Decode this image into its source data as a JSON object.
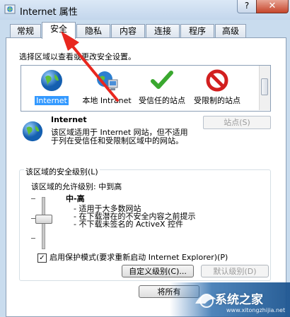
{
  "window": {
    "title": "Internet 属性",
    "help_label": "?",
    "close_label": "✕"
  },
  "tabs": [
    {
      "label": "常规",
      "active": false
    },
    {
      "label": "安全",
      "active": true
    },
    {
      "label": "隐私",
      "active": false
    },
    {
      "label": "内容",
      "active": false
    },
    {
      "label": "连接",
      "active": false
    },
    {
      "label": "程序",
      "active": false
    },
    {
      "label": "高级",
      "active": false
    }
  ],
  "security": {
    "zone_prompt": "选择区域以查看或更改安全设置。",
    "zones": [
      {
        "icon": "globe-icon",
        "label": "Internet",
        "selected": true
      },
      {
        "icon": "intranet-icon",
        "label": "本地 Intranet",
        "selected": false
      },
      {
        "icon": "checkmark-icon",
        "label": "受信任的站点",
        "selected": false
      },
      {
        "icon": "restricted-icon",
        "label": "受限制的站点",
        "selected": false
      }
    ],
    "zone_title": "Internet",
    "sites_button": "站点(S)",
    "zone_description": "该区域适用于 Internet 网站，但不适用于列在受信任和受限制区域中的网站。",
    "level_group_label": "该区域的安全级别(L)",
    "allowed_levels": "该区域的允许级别: 中到高",
    "level_name": "中-高",
    "level_bullets": [
      "- 适用于大多数网站",
      "- 在下载潜在的不安全内容之前提示",
      "- 不下载未签名的 ActiveX 控件"
    ],
    "slider_value": "中-高",
    "protected_mode_label": "启用保护模式(要求重新启动 Internet Explorer)(P)",
    "protected_mode_checked": true,
    "custom_level_button": "自定义级别(C)...",
    "default_level_button": "默认级别(D)",
    "reset_all_button": "将所有"
  },
  "watermark": {
    "brand": "系统之家",
    "url": "www.xitongzhijia.net"
  },
  "colors": {
    "selection": "#3399ff",
    "annotation_arrow": "#e8271f"
  }
}
